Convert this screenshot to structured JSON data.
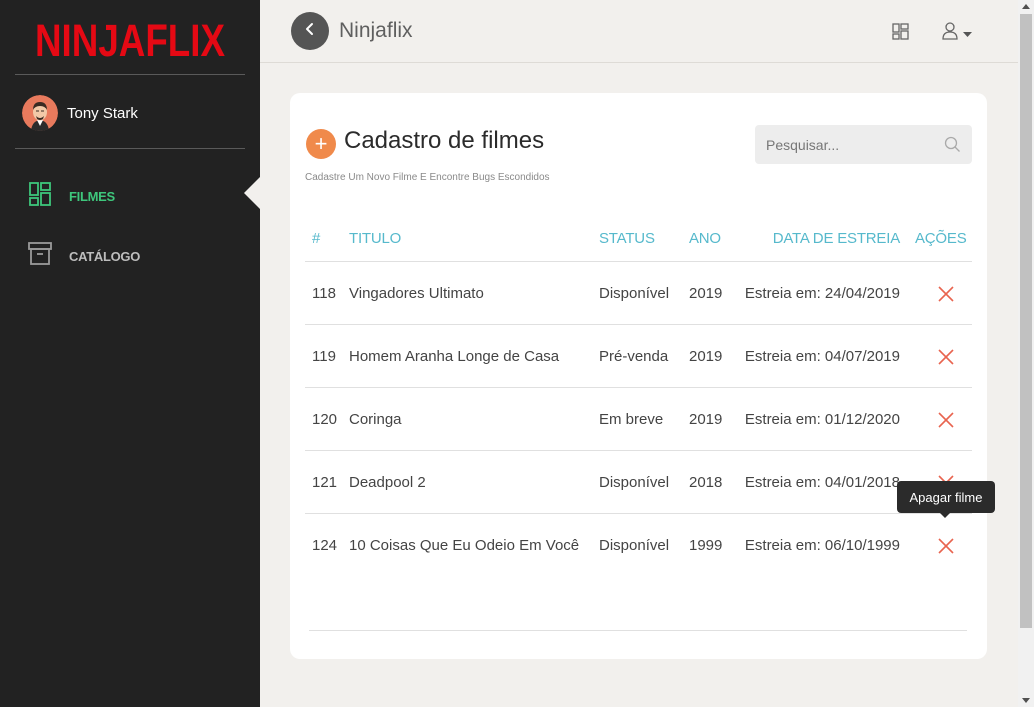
{
  "app": {
    "logo_text": "NINJAFLIX",
    "header_title": "Ninjaflix"
  },
  "user": {
    "name": "Tony Stark"
  },
  "sidebar": {
    "items": [
      {
        "label": "FILMES",
        "icon": "dashboard-icon",
        "active": true
      },
      {
        "label": "CATÁLOGO",
        "icon": "archive-icon",
        "active": false
      }
    ]
  },
  "page": {
    "title": "Cadastro de filmes",
    "subtitle": "Cadastre Um Novo Filme E Encontre Bugs Escondidos",
    "add_label": "+",
    "search_placeholder": "Pesquisar..."
  },
  "table": {
    "headers": {
      "id": "#",
      "titulo": "TITULO",
      "status": "STATUS",
      "ano": "ANO",
      "data": "DATA DE ESTREIA",
      "acoes": "AÇÕES"
    },
    "rows": [
      {
        "id": "118",
        "titulo": "Vingadores Ultimato",
        "status": "Disponível",
        "ano": "2019",
        "data": "Estreia em: 24/04/2019"
      },
      {
        "id": "119",
        "titulo": "Homem Aranha Longe de Casa",
        "status": "Pré-venda",
        "ano": "2019",
        "data": "Estreia em: 04/07/2019"
      },
      {
        "id": "120",
        "titulo": "Coringa",
        "status": "Em breve",
        "ano": "2019",
        "data": "Estreia em: 01/12/2020"
      },
      {
        "id": "121",
        "titulo": "Deadpool 2",
        "status": "Disponível",
        "ano": "2018",
        "data": "Estreia em: 04/01/2018"
      },
      {
        "id": "124",
        "titulo": "10 Coisas Que Eu Odeio Em Você",
        "status": "Disponível",
        "ano": "1999",
        "data": "Estreia em: 06/10/1999"
      }
    ]
  },
  "tooltip": {
    "text": "Apagar filme"
  },
  "colors": {
    "brand": "#e50914",
    "accent": "#56b9cc",
    "active_nav": "#3ec77c",
    "add_button": "#f08a4b",
    "delete": "#e8644f",
    "sidebar_bg": "#222222"
  }
}
